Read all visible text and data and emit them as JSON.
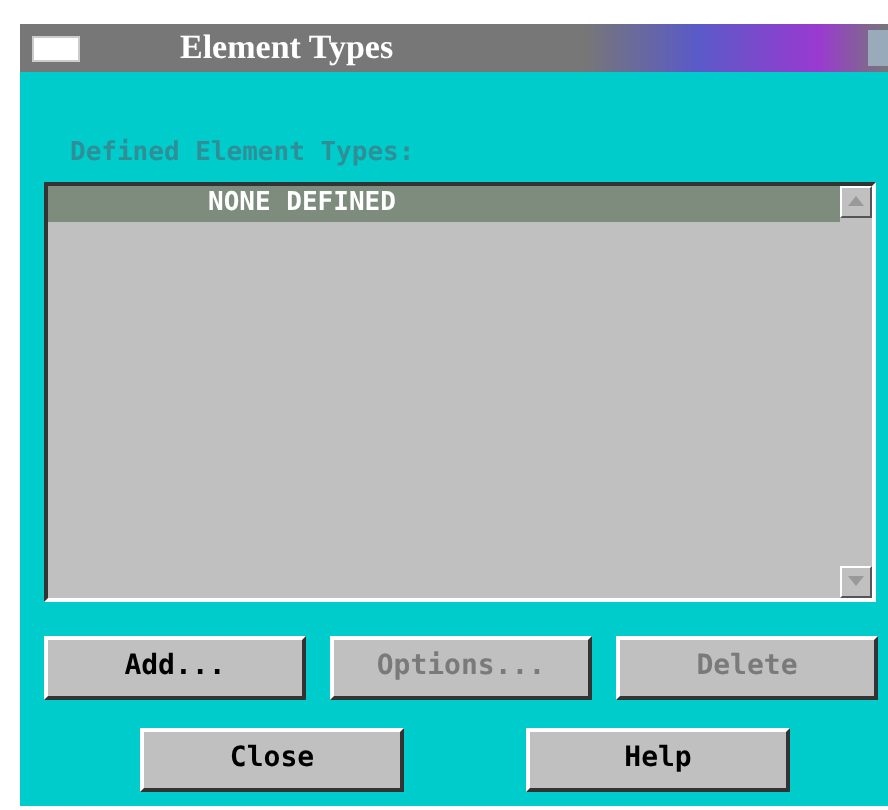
{
  "window": {
    "title": "Element Types"
  },
  "list": {
    "label": "Defined Element Types:",
    "label_disabled": true,
    "items": [
      {
        "text": "NONE DEFINED",
        "selected": true
      }
    ]
  },
  "action_buttons": [
    {
      "label": "Add...",
      "disabled": false
    },
    {
      "label": "Options...",
      "disabled": true
    },
    {
      "label": "Delete",
      "disabled": true
    }
  ],
  "dialog_buttons": [
    {
      "label": "Close"
    },
    {
      "label": "Help"
    }
  ]
}
